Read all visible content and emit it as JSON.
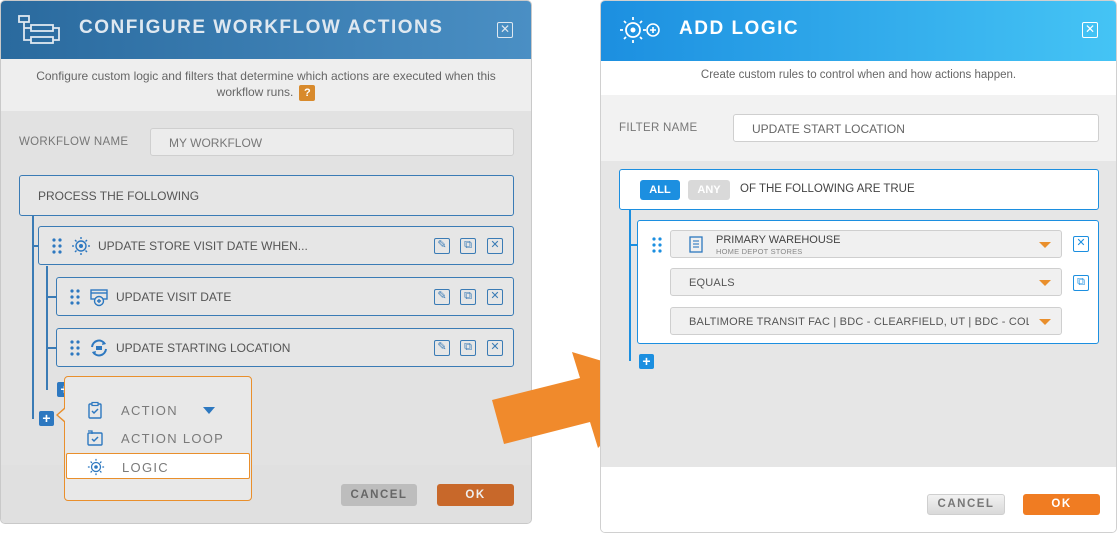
{
  "left_dialog": {
    "title": "CONFIGURE WORKFLOW ACTIONS",
    "subtitle": "Configure custom logic and filters that determine which actions are executed when this workflow runs.",
    "help_badge": "?",
    "workflow_name_label": "WORKFLOW NAME",
    "workflow_name_value": "MY WORKFLOW",
    "process_label": "PROCESS THE FOLLOWING",
    "rows": [
      {
        "label": "UPDATE STORE VISIT DATE WHEN...",
        "icon": "logic-icon"
      },
      {
        "label": "UPDATE VISIT DATE",
        "icon": "calendar-update-icon"
      },
      {
        "label": "UPDATE STARTING LOCATION",
        "icon": "location-sync-icon"
      }
    ],
    "menu": {
      "items": [
        {
          "label": "ACTION",
          "icon": "clipboard-check-icon"
        },
        {
          "label": "ACTION LOOP",
          "icon": "loop-check-icon"
        },
        {
          "label": "LOGIC",
          "icon": "logic-icon"
        }
      ]
    },
    "cancel_label": "CANCEL",
    "ok_label": "OK"
  },
  "right_dialog": {
    "title": "ADD LOGIC",
    "subtitle": "Create custom rules to control when and how actions happen.",
    "filter_name_label": "FILTER NAME",
    "filter_name_value": "UPDATE START LOCATION",
    "all_label": "ALL",
    "any_label": "ANY",
    "condition_text": "OF THE FOLLOWING ARE TRUE",
    "field_select": {
      "main": "PRIMARY WAREHOUSE",
      "sub": "HOME DEPOT STORES"
    },
    "operator_select": "EQUALS",
    "value_select": "BALTIMORE TRANSIT FAC | BDC - CLEARFIELD, UT | BDC - COLU",
    "cancel_label": "CANCEL",
    "ok_label": "OK"
  },
  "colors": {
    "left_header": "#2a6a9e",
    "right_header": "#1c8fe0",
    "accent_orange": "#f07c22",
    "arrow": "#f08a2c"
  }
}
